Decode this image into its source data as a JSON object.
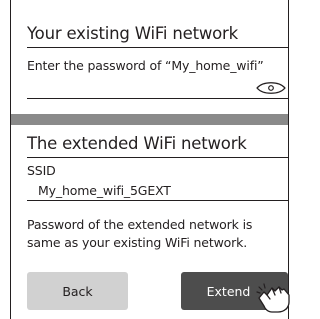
{
  "existing_network": {
    "title": "Your existing WiFi network",
    "password_prompt": "Enter the password of “My_home_wifi”",
    "password_value": "",
    "visibility_icon": "eye-icon"
  },
  "extended_network": {
    "title": "The extended WiFi network",
    "ssid_label": "SSID",
    "ssid_value": "My_home_wifi_5GEXT",
    "note_line1": "Password of the extended network is",
    "note_line2": "same as your existing WiFi network."
  },
  "buttons": {
    "back_label": "Back",
    "extend_label": "Extend",
    "pointer_icon": "hand-pointer-icon"
  },
  "colors": {
    "text": "#231f20",
    "divider_bar": "#8a8a8a",
    "back_button": "#d1d1d1",
    "extend_button": "#4d4d4d",
    "extend_text": "#ffffff"
  }
}
